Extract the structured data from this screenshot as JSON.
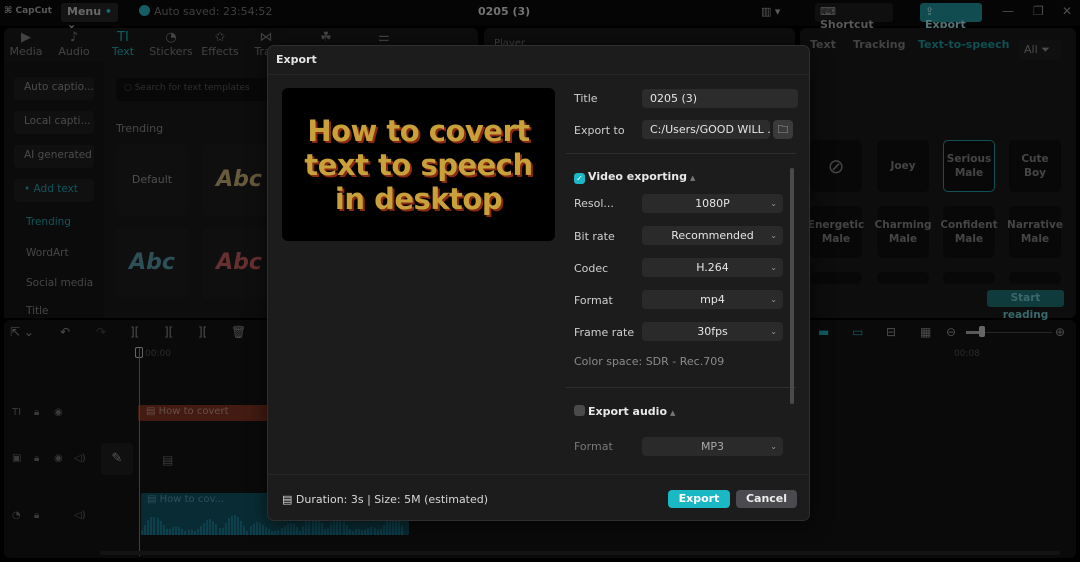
{
  "titlebar": {
    "app_name": "CapCut",
    "menu_label": "Menu",
    "autosave_text": "Auto saved: 23:54:52",
    "project_title": "0205 (3)",
    "shortcut_label": "Shortcut",
    "export_label": "Export",
    "window_controls": [
      "minimize",
      "restore",
      "close"
    ]
  },
  "media_tabs": [
    {
      "label": "Media",
      "icon": "media-icon",
      "glyph": "▶"
    },
    {
      "label": "Audio",
      "icon": "audio-icon",
      "glyph": "♪"
    },
    {
      "label": "Text",
      "icon": "text-icon",
      "glyph": "TI",
      "active": true
    },
    {
      "label": "Stickers",
      "icon": "sticker-icon",
      "glyph": "◔"
    },
    {
      "label": "Effects",
      "icon": "effects-icon",
      "glyph": "✩"
    },
    {
      "label": "Tran",
      "icon": "transitions-icon",
      "glyph": "⋈"
    },
    {
      "label": "",
      "icon": "filters-icon",
      "glyph": "☘"
    },
    {
      "label": "",
      "icon": "adjust-icon",
      "glyph": "⚌"
    }
  ],
  "text_sidebar": {
    "buttons": [
      "Auto captio...",
      "Local capti...",
      "AI generated",
      "Add text"
    ],
    "links": [
      "Trending",
      "WordArt",
      "Social media",
      "Title"
    ]
  },
  "text_templates": {
    "search_placeholder": "Search for text templates",
    "section_label": "Trending",
    "items": [
      {
        "label": "Default"
      },
      {
        "label": "Abc",
        "color": "#b8a060"
      },
      {
        "label": "Abc",
        "color": "#4a8a9a"
      },
      {
        "label": "Abc",
        "color": "#c04040"
      }
    ]
  },
  "player": {
    "label": "Player"
  },
  "right_panel": {
    "tabs": [
      "Text",
      "Tracking",
      "Text-to-speech"
    ],
    "active_tab": "Text-to-speech",
    "filter_label": "All",
    "voices": [
      {
        "label": "",
        "icon": "none-icon"
      },
      {
        "label": "Joey"
      },
      {
        "label": "Serious Male",
        "selected": true
      },
      {
        "label": "Cute Boy"
      },
      {
        "label": "Energetic Male"
      },
      {
        "label": "Charming Male"
      },
      {
        "label": "Confident Male"
      },
      {
        "label": "Narrative Male"
      }
    ],
    "start_reading_label": "Start reading"
  },
  "timeline": {
    "ruler_start": "00:00",
    "ruler_mid": "00:08",
    "text_clip_label": "How to covert",
    "audio_clip_label": "How to cov...",
    "zoom_level": 0.2
  },
  "export_dialog": {
    "title": "Export",
    "preview_text": "How to covert text to speech in desktop",
    "fields": {
      "title_label": "Title",
      "title_value": "0205 (3)",
      "export_to_label": "Export to",
      "export_to_value": "C:/Users/GOOD WILL ..."
    },
    "video_section": {
      "label": "Video exporting",
      "checked": true,
      "rows": [
        {
          "label": "Resol...",
          "value": "1080P"
        },
        {
          "label": "Bit rate",
          "value": "Recommended"
        },
        {
          "label": "Codec",
          "value": "H.264"
        },
        {
          "label": "Format",
          "value": "mp4"
        },
        {
          "label": "Frame rate",
          "value": "30fps"
        }
      ],
      "color_space": "Color space: SDR - Rec.709"
    },
    "audio_section": {
      "label": "Export audio",
      "checked": false,
      "rows": [
        {
          "label": "Format",
          "value": "MP3"
        }
      ]
    },
    "footer_info": "Duration: 3s | Size: 5M (estimated)",
    "export_button": "Export",
    "cancel_button": "Cancel",
    "accent_color": "#1ab7c4"
  }
}
